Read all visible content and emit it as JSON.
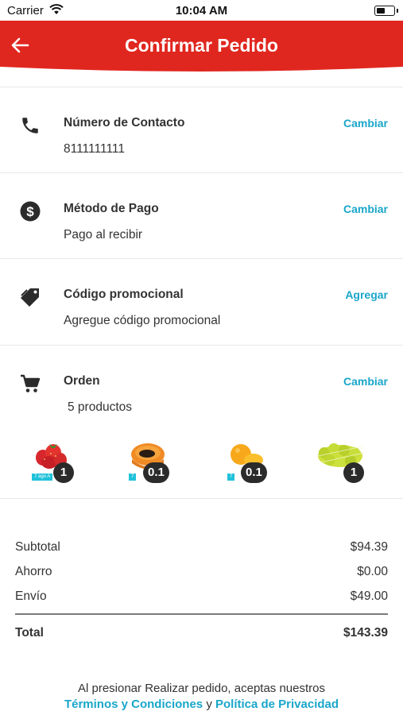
{
  "status_bar": {
    "carrier": "Carrier",
    "time": "10:04 AM"
  },
  "header": {
    "title": "Confirmar Pedido",
    "color": "#e0271f"
  },
  "accent_color": "#19a6c9",
  "sections": {
    "contact": {
      "icon": "phone-icon",
      "label": "Número de Contacto",
      "value": "8111111111",
      "action": "Cambiar"
    },
    "payment": {
      "icon": "dollar-circle-icon",
      "label": "Método de Pago",
      "value": "Pago al recibir",
      "action": "Cambiar"
    },
    "promo": {
      "icon": "tag-icon",
      "label": "Código promocional",
      "value": "Agregue código promocional",
      "action": "Agregar"
    },
    "order": {
      "icon": "cart-icon",
      "label": "Orden",
      "value": "5 productos",
      "action": "Cambiar"
    }
  },
  "products": [
    {
      "name": "strawberries",
      "tag": "7 ago A",
      "qty": "1"
    },
    {
      "name": "papaya",
      "tag": "7",
      "qty": "0.1"
    },
    {
      "name": "orange",
      "tag": "7",
      "qty": "0.1"
    },
    {
      "name": "limes",
      "tag": "",
      "qty": "1"
    }
  ],
  "totals": {
    "subtotal_label": "Subtotal",
    "subtotal": "$94.39",
    "savings_label": "Ahorro",
    "savings": "$0.00",
    "shipping_label": "Envío",
    "shipping": "$49.00",
    "total_label": "Total",
    "total": "$143.39"
  },
  "terms": {
    "prefix": "Al presionar Realizar pedido, aceptas nuestros",
    "terms_link": "Términos y Condiciones",
    "connector": "y",
    "privacy_link": "Política de Privacidad"
  }
}
